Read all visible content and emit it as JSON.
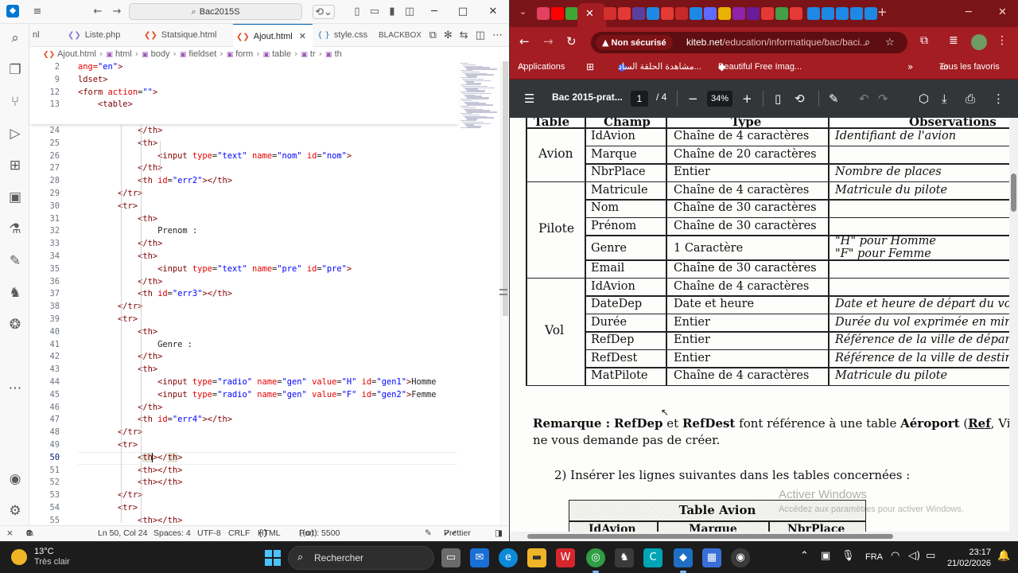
{
  "vscode": {
    "command_center": "Bac2015S",
    "tabs": [
      {
        "label": "nl",
        "icon": "html-icon"
      },
      {
        "label": "Liste.php",
        "icon": "php-icon"
      },
      {
        "label": "Statsique.html",
        "icon": "html-icon"
      },
      {
        "label": "Ajout.html",
        "icon": "html-icon",
        "active": true
      },
      {
        "label": "style.css",
        "icon": "css-icon"
      },
      {
        "label": "BLACKBOX",
        "icon": "blackbox-icon"
      }
    ],
    "breadcrumb": [
      "Ajout.html",
      "html",
      "body",
      "fieldset",
      "form",
      "table",
      "tr",
      "th"
    ],
    "sticky_lines": [
      {
        "n": "2",
        "indent": "",
        "tokens": [
          [
            "at",
            "ang="
          ],
          [
            "st",
            "\"en\""
          ],
          [
            "tg",
            ">"
          ]
        ]
      },
      {
        "n": "9",
        "indent": "",
        "tokens": [
          [
            "tg",
            "ldset>"
          ]
        ]
      },
      {
        "n": "12",
        "indent": "",
        "tokens": [
          [
            "tg",
            "<form "
          ],
          [
            "at",
            "action"
          ],
          [
            "tx",
            "="
          ],
          [
            "st",
            "\"\""
          ],
          [
            "tg",
            ">"
          ]
        ]
      },
      {
        "n": "13",
        "indent": "    ",
        "tokens": [
          [
            "tg",
            "<table>"
          ]
        ]
      }
    ],
    "lines": [
      {
        "n": "24",
        "indent": "            ",
        "tokens": [
          [
            "tg",
            "</th>"
          ]
        ]
      },
      {
        "n": "25",
        "indent": "            ",
        "tokens": [
          [
            "tg",
            "<th>"
          ]
        ]
      },
      {
        "n": "26",
        "indent": "                ",
        "tokens": [
          [
            "tg",
            "<input "
          ],
          [
            "at",
            "type"
          ],
          [
            "tx",
            "="
          ],
          [
            "st",
            "\"text\" "
          ],
          [
            "at",
            "name"
          ],
          [
            "tx",
            "="
          ],
          [
            "st",
            "\"nom\" "
          ],
          [
            "at",
            "id"
          ],
          [
            "tx",
            "="
          ],
          [
            "st",
            "\"nom\""
          ],
          [
            "tg",
            ">"
          ]
        ]
      },
      {
        "n": "27",
        "indent": "            ",
        "tokens": [
          [
            "tg",
            "</th>"
          ]
        ]
      },
      {
        "n": "28",
        "indent": "            ",
        "tokens": [
          [
            "tg",
            "<th "
          ],
          [
            "at",
            "id"
          ],
          [
            "tx",
            "="
          ],
          [
            "st",
            "\"err2\""
          ],
          [
            "tg",
            "></th>"
          ]
        ]
      },
      {
        "n": "29",
        "indent": "        ",
        "tokens": [
          [
            "tg",
            "</tr>"
          ]
        ]
      },
      {
        "n": "30",
        "indent": "        ",
        "tokens": [
          [
            "tg",
            "<tr>"
          ]
        ]
      },
      {
        "n": "31",
        "indent": "            ",
        "tokens": [
          [
            "tg",
            "<th>"
          ]
        ]
      },
      {
        "n": "32",
        "indent": "                ",
        "tokens": [
          [
            "tx",
            "Prenom :"
          ]
        ]
      },
      {
        "n": "33",
        "indent": "            ",
        "tokens": [
          [
            "tg",
            "</th>"
          ]
        ]
      },
      {
        "n": "34",
        "indent": "            ",
        "tokens": [
          [
            "tg",
            "<th>"
          ]
        ]
      },
      {
        "n": "35",
        "indent": "                ",
        "tokens": [
          [
            "tg",
            "<input "
          ],
          [
            "at",
            "type"
          ],
          [
            "tx",
            "="
          ],
          [
            "st",
            "\"text\" "
          ],
          [
            "at",
            "name"
          ],
          [
            "tx",
            "="
          ],
          [
            "st",
            "\"pre\" "
          ],
          [
            "at",
            "id"
          ],
          [
            "tx",
            "="
          ],
          [
            "st",
            "\"pre\""
          ],
          [
            "tg",
            ">"
          ]
        ]
      },
      {
        "n": "36",
        "indent": "            ",
        "tokens": [
          [
            "tg",
            "</th>"
          ]
        ]
      },
      {
        "n": "37",
        "indent": "            ",
        "tokens": [
          [
            "tg",
            "<th "
          ],
          [
            "at",
            "id"
          ],
          [
            "tx",
            "="
          ],
          [
            "st",
            "\"err3\""
          ],
          [
            "tg",
            "></th>"
          ]
        ]
      },
      {
        "n": "38",
        "indent": "        ",
        "tokens": [
          [
            "tg",
            "</tr>"
          ]
        ]
      },
      {
        "n": "39",
        "indent": "        ",
        "tokens": [
          [
            "tg",
            "<tr>"
          ]
        ]
      },
      {
        "n": "40",
        "indent": "            ",
        "tokens": [
          [
            "tg",
            "<th>"
          ]
        ]
      },
      {
        "n": "41",
        "indent": "                ",
        "tokens": [
          [
            "tx",
            "Genre :"
          ]
        ]
      },
      {
        "n": "42",
        "indent": "            ",
        "tokens": [
          [
            "tg",
            "</th>"
          ]
        ]
      },
      {
        "n": "43",
        "indent": "            ",
        "tokens": [
          [
            "tg",
            "<th>"
          ]
        ]
      },
      {
        "n": "44",
        "indent": "                ",
        "tokens": [
          [
            "tg",
            "<input "
          ],
          [
            "at",
            "type"
          ],
          [
            "tx",
            "="
          ],
          [
            "st",
            "\"radio\" "
          ],
          [
            "at",
            "name"
          ],
          [
            "tx",
            "="
          ],
          [
            "st",
            "\"gen\" "
          ],
          [
            "at",
            "value"
          ],
          [
            "tx",
            "="
          ],
          [
            "st",
            "\"H\" "
          ],
          [
            "at",
            "id"
          ],
          [
            "tx",
            "="
          ],
          [
            "st",
            "\"gen1\""
          ],
          [
            "tg",
            ">"
          ],
          [
            "tx",
            "Homme"
          ]
        ]
      },
      {
        "n": "45",
        "indent": "                ",
        "tokens": [
          [
            "tg",
            "<input "
          ],
          [
            "at",
            "type"
          ],
          [
            "tx",
            "="
          ],
          [
            "st",
            "\"radio\" "
          ],
          [
            "at",
            "name"
          ],
          [
            "tx",
            "="
          ],
          [
            "st",
            "\"gen\" "
          ],
          [
            "at",
            "value"
          ],
          [
            "tx",
            "="
          ],
          [
            "st",
            "\"F\" "
          ],
          [
            "at",
            "id"
          ],
          [
            "tx",
            "="
          ],
          [
            "st",
            "\"gen2\""
          ],
          [
            "tg",
            ">"
          ],
          [
            "tx",
            "Femme"
          ]
        ]
      },
      {
        "n": "46",
        "indent": "            ",
        "tokens": [
          [
            "tg",
            "</th>"
          ]
        ]
      },
      {
        "n": "47",
        "indent": "            ",
        "tokens": [
          [
            "tg",
            "<th "
          ],
          [
            "at",
            "id"
          ],
          [
            "tx",
            "="
          ],
          [
            "st",
            "\"err4\""
          ],
          [
            "tg",
            "></th>"
          ]
        ]
      },
      {
        "n": "48",
        "indent": "        ",
        "tokens": [
          [
            "tg",
            "</tr>"
          ]
        ]
      },
      {
        "n": "49",
        "indent": "        ",
        "tokens": [
          [
            "tg",
            "<tr>"
          ]
        ]
      },
      {
        "n": "50",
        "indent": "            ",
        "current": true,
        "tokens": [
          [
            "tg",
            "<"
          ],
          [
            "tgh",
            "th"
          ],
          [
            "cur",
            ""
          ],
          [
            "tg",
            "></"
          ],
          [
            "tgh",
            "th"
          ],
          [
            "tg",
            ">"
          ]
        ]
      },
      {
        "n": "51",
        "indent": "            ",
        "tokens": [
          [
            "tg",
            "<th></th>"
          ]
        ]
      },
      {
        "n": "52",
        "indent": "            ",
        "tokens": [
          [
            "tg",
            "<th></th>"
          ]
        ]
      },
      {
        "n": "53",
        "indent": "        ",
        "tokens": [
          [
            "tg",
            "</tr>"
          ]
        ]
      },
      {
        "n": "54",
        "indent": "        ",
        "tokens": [
          [
            "tg",
            "<tr>"
          ]
        ]
      },
      {
        "n": "55",
        "indent": "            ",
        "tokens": [
          [
            "tg",
            "<th></th>"
          ]
        ]
      }
    ],
    "status": {
      "errors": "0",
      "warnings": "0",
      "position": "Ln 50, Col 24",
      "spaces": "Spaces: 4",
      "encoding": "UTF-8",
      "eol": "CRLF",
      "language": "HTML",
      "port": "Port : 5500",
      "formatter": "Prettier"
    }
  },
  "chrome": {
    "security": "Non sécurisé",
    "url_host": "kiteb.net",
    "url_path": "/education/informatique/bac/baci...",
    "bookmarks": [
      "Applications",
      "مشاهدة الحلقة الساد...",
      "Beautiful Free Imag...",
      "Tous les favoris"
    ],
    "pdf": {
      "title": "Bac 2015-prat...",
      "page": "1",
      "page_total": "/ 4",
      "zoom": "34%"
    }
  },
  "document": {
    "headers": [
      "Table",
      "Champ",
      "Type",
      "Observations"
    ],
    "groups": [
      "Avion",
      "Pilote",
      "Vol"
    ],
    "rows": [
      {
        "champ": "IdAvion",
        "type": "Chaîne de 4 caractères",
        "obs": "Identifiant de l'avion"
      },
      {
        "champ": "Marque",
        "type": "Chaîne de 20 caractères",
        "obs": ""
      },
      {
        "champ": "NbrPlace",
        "type": "Entier",
        "obs": "Nombre de places"
      },
      {
        "champ": "Matricule",
        "type": "Chaîne de 4 caractères",
        "obs": "Matricule du pilote"
      },
      {
        "champ": "Nom",
        "type": "Chaîne de 30 caractères",
        "obs": ""
      },
      {
        "champ": "Prénom",
        "type": "Chaîne de 30 caractères",
        "obs": ""
      },
      {
        "champ": "Genre",
        "type": "1 Caractère",
        "obs": "\"H\" pour Homme",
        "obs2": "\"F\" pour Femme"
      },
      {
        "champ": "Email",
        "type": "Chaîne de 30 caractères",
        "obs": ""
      },
      {
        "champ": "IdAvion",
        "type": "Chaîne de 4 caractères",
        "obs": ""
      },
      {
        "champ": "DateDep",
        "type": "Date et heure",
        "obs": "Date et heure de départ du vo"
      },
      {
        "champ": "Durée",
        "type": "Entier",
        "obs": "Durée du vol exprimée en min"
      },
      {
        "champ": "RefDep",
        "type": "Entier",
        "obs": "Référence de la ville de départ"
      },
      {
        "champ": "RefDest",
        "type": "Entier",
        "obs": "Référence de la ville de destin"
      },
      {
        "champ": "MatPilote",
        "type": "Chaîne de 4 caractères",
        "obs": "Matricule du pilote"
      }
    ],
    "remark_label": "Remarque :",
    "remark_f1": "RefDep",
    "remark_et": "et",
    "remark_f2": "RefDest",
    "remark_mid": "font référence à une table",
    "remark_table": "Aéroport",
    "remark_open": "(",
    "remark_ref": "Ref",
    "remark_end": ", Ville",
    "remark_line2": "ne vous demande pas de créer.",
    "task2": "2)  Insérer les lignes suivantes dans les tables concernées :",
    "table_avion_title": "Table Avion",
    "table_avion_cols": [
      "IdAvion",
      "Marque",
      "NbrPlace"
    ],
    "watermark_title": "Activer Windows",
    "watermark_sub": "Accédez aux paramètres pour activer Windows."
  },
  "taskbar": {
    "temp": "13°C",
    "weather": "Très clair",
    "search": "Rechercher",
    "lang": "FRA",
    "time": "23:17",
    "date": "21/02/2026"
  },
  "colors": {
    "chrome_theme": "#a31d22",
    "vscode_accent": "#005fb8"
  }
}
